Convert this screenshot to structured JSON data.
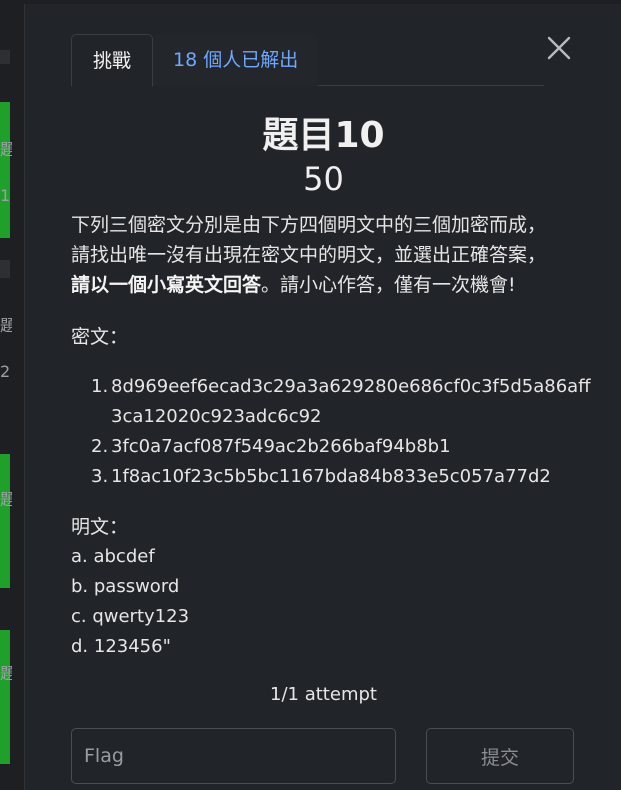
{
  "background": {
    "side_chars": [
      "題",
      "1",
      "題",
      "2",
      "題",
      "題"
    ]
  },
  "tabs": [
    {
      "label": "挑戰"
    },
    {
      "label": "18 個人已解出"
    }
  ],
  "challenge": {
    "title": "題目10",
    "value": "50",
    "description_line1": "下列三個密文分別是由下方四個明文中的三個加密而成，",
    "description_line2": "請找出唯一沒有出現在密文中的明文，並選出正確答案，",
    "description_bold": "請以一個小寫英文回答",
    "description_tail": "。請小心作答，僅有一次機會!",
    "cipher_label": "密文：",
    "ciphertexts": [
      {
        "num": "1.",
        "text": "8d969eef6ecad3c29a3a629280e686cf0c3f5d5a86aff3ca12020c923adc6c92"
      },
      {
        "num": "2.",
        "text": "3fc0a7acf087f549ac2b266baf94b8b1"
      },
      {
        "num": "3.",
        "text": "1f8ac10f23c5b5bc1167bda84b833e5c057a77d2"
      }
    ],
    "plain_label": "明文：",
    "plaintexts": [
      "a. abcdef",
      "b. password",
      "c. qwerty123",
      "d. 123456\""
    ],
    "attempts": "1/1 attempt"
  },
  "form": {
    "flag_placeholder": "Flag",
    "flag_value": "",
    "submit_label": "提交"
  },
  "colors": {
    "accent_link": "#6ea8ff",
    "modal_bg": "#212428",
    "bg_green": "#1fa02a"
  }
}
